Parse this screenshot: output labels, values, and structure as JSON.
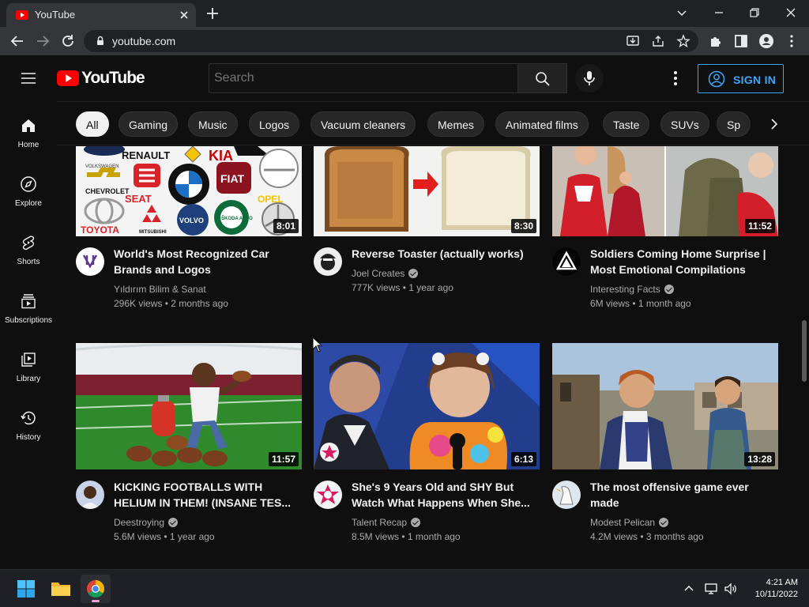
{
  "browser": {
    "tab_title": "YouTube",
    "url": "youtube.com"
  },
  "header": {
    "logo_text": "YouTube",
    "search_placeholder": "Search",
    "signin_label": "SIGN IN"
  },
  "chips": [
    "All",
    "Gaming",
    "Music",
    "Logos",
    "Vacuum cleaners",
    "Memes",
    "Animated films",
    "Taste",
    "SUVs",
    "Sp"
  ],
  "sidebar": {
    "items": [
      {
        "label": "Home",
        "icon": "home-icon"
      },
      {
        "label": "Explore",
        "icon": "compass-icon"
      },
      {
        "label": "Shorts",
        "icon": "shorts-icon"
      },
      {
        "label": "Subscriptions",
        "icon": "subscriptions-icon"
      },
      {
        "label": "Library",
        "icon": "library-icon"
      },
      {
        "label": "History",
        "icon": "history-icon"
      }
    ]
  },
  "videos": [
    {
      "title": "World's Most Recognized Car Brands and Logos",
      "channel": "Yıldırım Bilim & Sanat",
      "verified": false,
      "meta": "296K views • 2 months ago",
      "duration": "8:01"
    },
    {
      "title": "Reverse Toaster (actually works)",
      "channel": "Joel Creates",
      "verified": true,
      "meta": "777K views • 1 year ago",
      "duration": "8:30"
    },
    {
      "title": "Soldiers Coming Home Surprise | Most Emotional Compilations",
      "channel": "Interesting Facts",
      "verified": true,
      "meta": "6M views • 1 month ago",
      "duration": "11:52"
    },
    {
      "title": "KICKING FOOTBALLS WITH HELIUM IN THEM! (INSANE TES...",
      "channel": "Deestroying",
      "verified": true,
      "meta": "5.6M views • 1 year ago",
      "duration": "11:57"
    },
    {
      "title": "She's 9 Years Old and SHY But Watch What Happens When She...",
      "channel": "Talent Recap",
      "verified": true,
      "meta": "8.5M views • 1 month ago",
      "duration": "6:13"
    },
    {
      "title": "The most offensive game ever made",
      "channel": "Modest Pelican",
      "verified": true,
      "meta": "4.2M views • 3 months ago",
      "duration": "13:28"
    }
  ],
  "car_logos": [
    "RENAULT",
    "VOLKSWAGEN",
    "CHEVROLET",
    "SEAT",
    "BMW",
    "FIAT",
    "OPEL",
    "TOYOTA",
    "MITSUBISHI",
    "VOLVO",
    "ŠKODA AUTO"
  ],
  "taskbar": {
    "time": "4:21 AM",
    "date": "10/11/2022"
  },
  "colors": {
    "background": "#0f0f0f",
    "accent": "#3ea6ff",
    "brand_red": "#ff0000"
  }
}
